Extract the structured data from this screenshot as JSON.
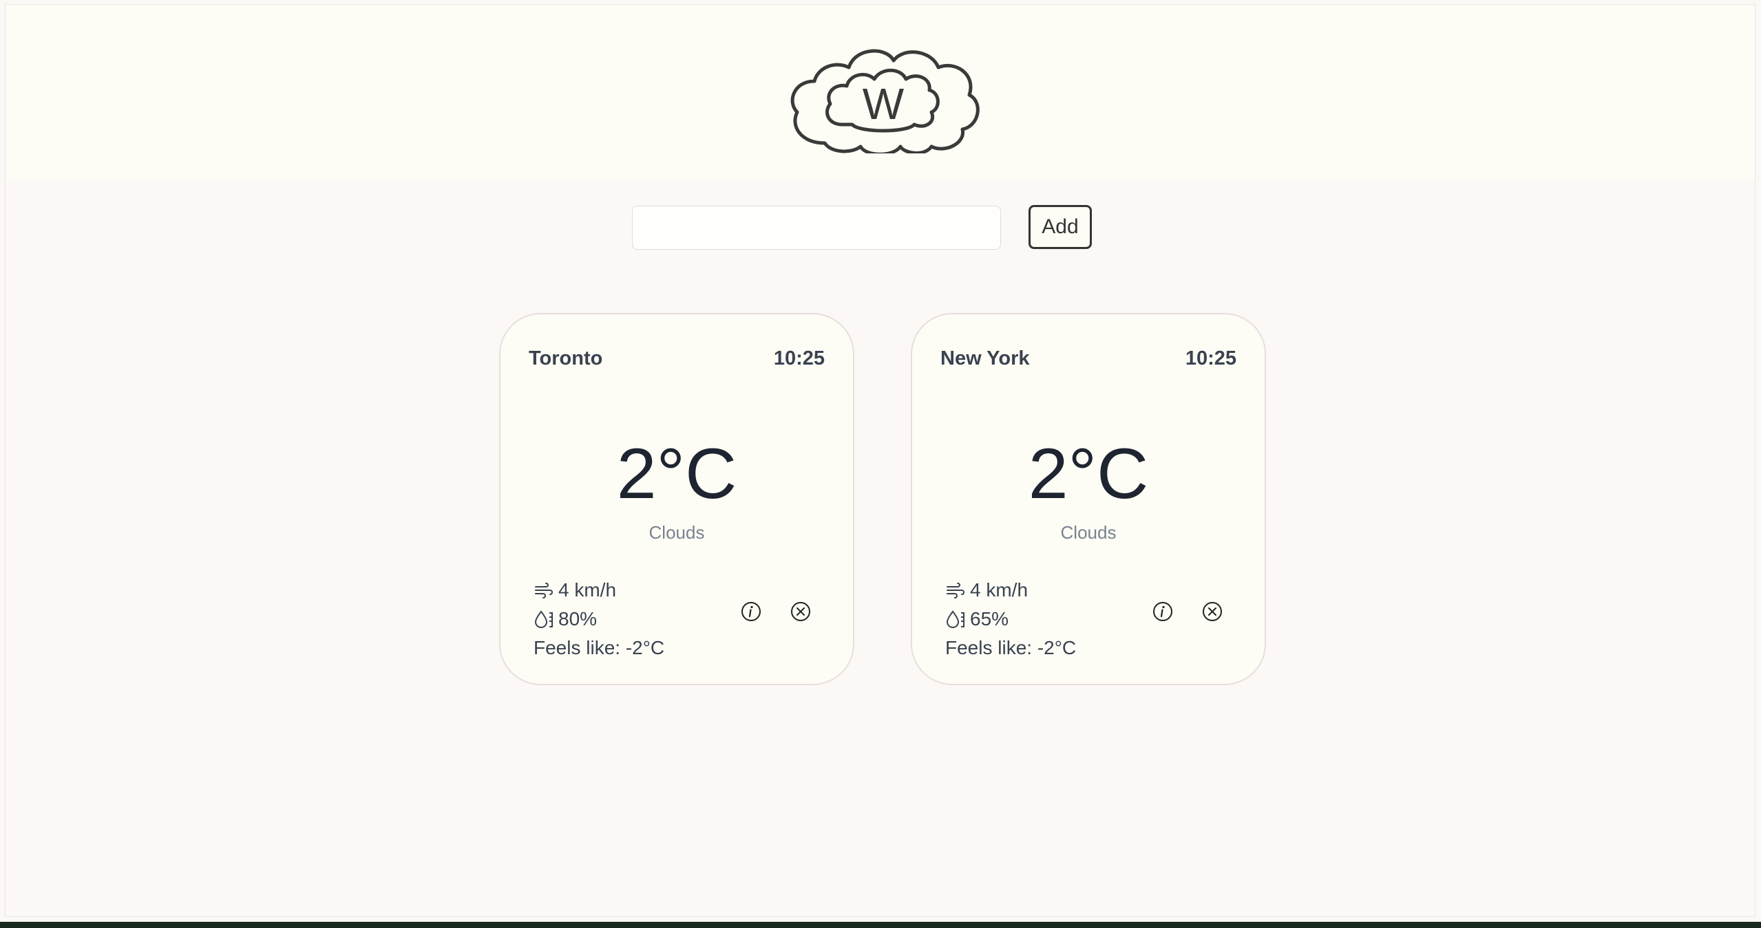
{
  "header": {
    "logo_letter": "W"
  },
  "search": {
    "value": "",
    "placeholder": "",
    "add_label": "Add"
  },
  "cards": [
    {
      "city": "Toronto",
      "time": "10:25",
      "temperature": "2°C",
      "condition": "Clouds",
      "wind": "4 km/h",
      "humidity": "80%",
      "feels_like": "Feels like: -2°C"
    },
    {
      "city": "New York",
      "time": "10:25",
      "temperature": "2°C",
      "condition": "Clouds",
      "wind": "4 km/h",
      "humidity": "65%",
      "feels_like": "Feels like: -2°C"
    }
  ],
  "icons": {
    "logo": "cloud-logo-icon",
    "wind": "wind-icon",
    "humidity": "humidity-drop-icon",
    "info": "info-icon",
    "close": "close-icon"
  },
  "colors": {
    "header_bg": "#fdfdf5",
    "page_bg": "#fcf8f6",
    "card_bg": "#fdfdf5",
    "text_dark": "#3a4250",
    "text_muted": "#7a8290"
  }
}
